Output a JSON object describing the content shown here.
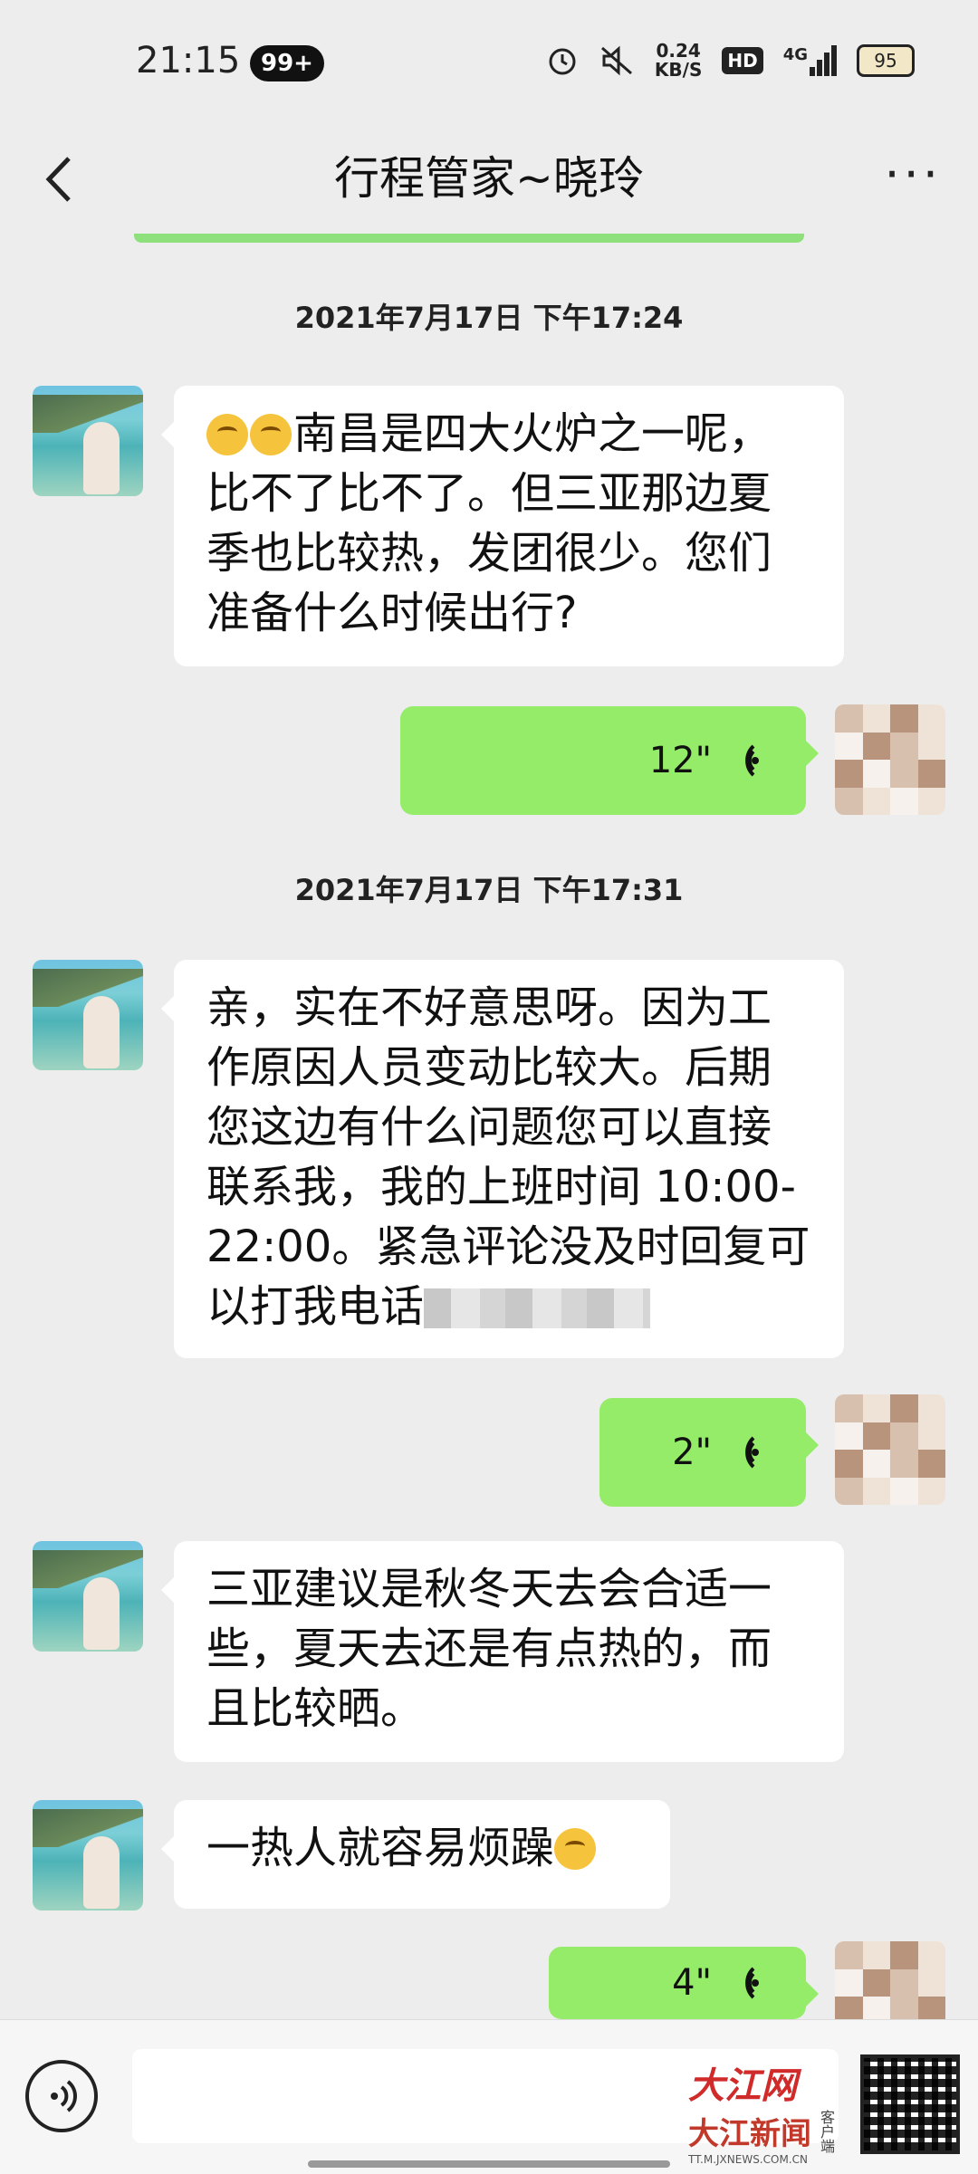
{
  "status_bar": {
    "time": "21:15",
    "notification_badge": "99+",
    "net_speed_value": "0.24",
    "net_speed_unit": "KB/S",
    "hd_label": "HD",
    "network_label": "4G",
    "battery_level": "95",
    "icons": [
      "alarm-icon",
      "mute-icon",
      "signal-icon",
      "battery-icon"
    ]
  },
  "header": {
    "title": "行程管家~晓玲",
    "back_icon": "chevron-left-icon",
    "more_label": "···"
  },
  "chat": {
    "timestamp_1": "2021年7月17日 下午17:24",
    "msg_1_text": "南昌是四大火炉之一呢，比不了比不了。但三亚那边夏季也比较热，发团很少。您们准备什么时候出行?",
    "msg_1_emoji": "thinking-face",
    "voice_1_duration": "12\"",
    "timestamp_2": "2021年7月17日 下午17:31",
    "msg_2_text": "亲，实在不好意思呀。因为工作原因人员变动比较大。后期您这边有什么问题您可以直接联系我，我的上班时间 10:00-22:00。紧急评论没及时回复可以打我电话",
    "voice_2_duration": "2\"",
    "msg_3_text": "三亚建议是秋冬天去会合适一些，夏天去还是有点热的，而且比较晒。",
    "msg_4_text": "一热人就容易烦躁",
    "msg_4_emoji": "sweat-face",
    "voice_3_duration": "4\""
  },
  "input_bar": {
    "voice_toggle_icon": "voice-icon"
  },
  "watermark": {
    "brand_top": "大江网",
    "brand_mid": "大江新闻",
    "brand_side": "客户端",
    "url": "TT.M.JXNEWS.COM.CN"
  },
  "colors": {
    "background": "#ededed",
    "outgoing_bubble": "#95ec69",
    "incoming_bubble": "#ffffff"
  }
}
